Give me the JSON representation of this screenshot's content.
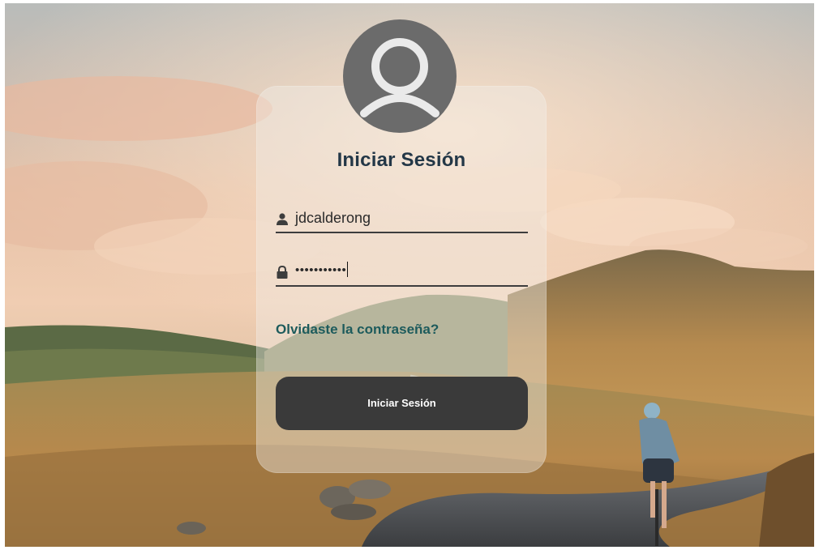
{
  "login": {
    "title": "Iniciar Sesión",
    "username": {
      "value": "jdcalderong",
      "icon": "user-icon"
    },
    "password": {
      "value": "•••••••••••",
      "icon": "lock-icon"
    },
    "forgot_link": "Olvidaste la contraseña?",
    "submit_label": "Iniciar Sesión",
    "avatar_icon": "user-avatar-icon"
  },
  "colors": {
    "title": "#233747",
    "link": "#1d5b5c",
    "button_bg": "#3a3a3a",
    "button_text": "#ffffff",
    "avatar": "#6b6b6b",
    "card_tint": "rgba(240,238,234,0.42)"
  }
}
